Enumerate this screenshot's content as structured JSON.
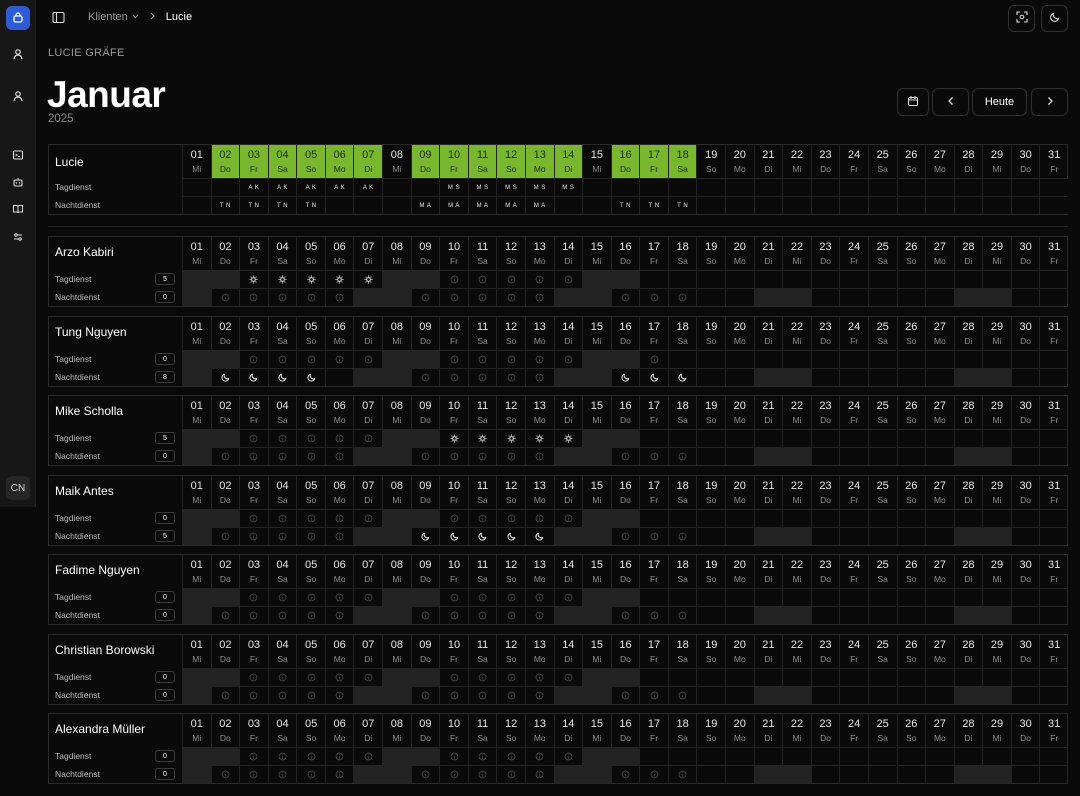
{
  "breadcrumb": {
    "parent": "Klienten",
    "current": "Lucie"
  },
  "client_name": "LUCIE GRÄFE",
  "month": "Januar",
  "year": "2025",
  "today_label": "Heute",
  "user_initials": "CN",
  "days": [
    {
      "d": "01",
      "w": "Mi"
    },
    {
      "d": "02",
      "w": "Do"
    },
    {
      "d": "03",
      "w": "Fr"
    },
    {
      "d": "04",
      "w": "Sa"
    },
    {
      "d": "05",
      "w": "So"
    },
    {
      "d": "06",
      "w": "Mo"
    },
    {
      "d": "07",
      "w": "Di"
    },
    {
      "d": "08",
      "w": "Mi"
    },
    {
      "d": "09",
      "w": "Do"
    },
    {
      "d": "10",
      "w": "Fr"
    },
    {
      "d": "11",
      "w": "Sa"
    },
    {
      "d": "12",
      "w": "So"
    },
    {
      "d": "13",
      "w": "Mo"
    },
    {
      "d": "14",
      "w": "Di"
    },
    {
      "d": "15",
      "w": "Mi"
    },
    {
      "d": "16",
      "w": "Do"
    },
    {
      "d": "17",
      "w": "Fr"
    },
    {
      "d": "18",
      "w": "Sa"
    },
    {
      "d": "19",
      "w": "So"
    },
    {
      "d": "20",
      "w": "Mo"
    },
    {
      "d": "21",
      "w": "Di"
    },
    {
      "d": "22",
      "w": "Mi"
    },
    {
      "d": "23",
      "w": "Do"
    },
    {
      "d": "24",
      "w": "Fr"
    },
    {
      "d": "25",
      "w": "Sa"
    },
    {
      "d": "26",
      "w": "So"
    },
    {
      "d": "27",
      "w": "Mo"
    },
    {
      "d": "28",
      "w": "Di"
    },
    {
      "d": "29",
      "w": "Mi"
    },
    {
      "d": "30",
      "w": "Do"
    },
    {
      "d": "31",
      "w": "Fr"
    }
  ],
  "labels": {
    "day": "Tagdienst",
    "night": "Nachtdienst"
  },
  "client_row": {
    "name": "Lucie",
    "covered_days": [
      2,
      3,
      4,
      5,
      6,
      7,
      9,
      10,
      11,
      12,
      13,
      14,
      16,
      17,
      18
    ],
    "tag_codes": {
      "3": "AK",
      "4": "AK",
      "5": "AK",
      "6": "AK",
      "7": "AK",
      "10": "MS",
      "11": "MS",
      "12": "MS",
      "13": "MS",
      "14": "MS"
    },
    "nacht_codes": {
      "2": "TN",
      "3": "TN",
      "4": "TN",
      "5": "TN",
      "9": "MA",
      "10": "MA",
      "11": "MA",
      "12": "MA",
      "13": "MA",
      "16": "TN",
      "17": "TN",
      "18": "TN"
    }
  },
  "colors": {
    "covered": "#79b72f",
    "accent": "#2d5bd6"
  },
  "employees": [
    {
      "name": "Arzo Kabiri",
      "tag_count": "5",
      "nacht_count": "0",
      "tag": {
        "3": "sun",
        "4": "sun",
        "5": "sun",
        "6": "sun",
        "7": "sun",
        "10": "info",
        "11": "info",
        "12": "info",
        "13": "info",
        "14": "info"
      },
      "nacht": {
        "2": "info",
        "3": "info",
        "4": "info",
        "5": "info",
        "6": "info",
        "9": "info",
        "10": "info",
        "11": "info",
        "12": "info",
        "13": "info",
        "16": "info",
        "17": "info",
        "18": "info"
      },
      "off_tag": [
        1,
        2,
        8,
        9,
        15,
        16
      ],
      "off_nacht": [
        1,
        7,
        8,
        14,
        15,
        21,
        22,
        28,
        29
      ]
    },
    {
      "name": "Tung Nguyen",
      "tag_count": "0",
      "nacht_count": "8",
      "tag": {
        "3": "info",
        "4": "info",
        "5": "info",
        "6": "info",
        "7": "info",
        "10": "info",
        "11": "info",
        "12": "info",
        "13": "info",
        "14": "info",
        "17": "info"
      },
      "nacht": {
        "2": "moon",
        "3": "moon",
        "4": "moon",
        "5": "moon",
        "9": "info",
        "10": "info",
        "11": "info",
        "12": "info",
        "13": "info",
        "16": "moon",
        "17": "moon",
        "18": "moon"
      },
      "off_tag": [
        1,
        2,
        8,
        9,
        15,
        16
      ],
      "off_nacht": [
        1,
        7,
        8,
        14,
        15,
        21,
        22,
        28,
        29
      ]
    },
    {
      "name": "Mike Scholla",
      "tag_count": "5",
      "nacht_count": "0",
      "tag": {
        "3": "info",
        "4": "info",
        "5": "info",
        "6": "info",
        "7": "info",
        "10": "sun",
        "11": "sun",
        "12": "sun",
        "13": "sun",
        "14": "sun"
      },
      "nacht": {
        "2": "info",
        "3": "info",
        "4": "info",
        "5": "info",
        "6": "info",
        "9": "info",
        "10": "info",
        "11": "info",
        "12": "info",
        "13": "info",
        "16": "info",
        "17": "info",
        "18": "info"
      },
      "off_tag": [
        1,
        2,
        8,
        9,
        15,
        16
      ],
      "off_nacht": [
        1,
        7,
        8,
        14,
        15,
        21,
        22,
        28,
        29
      ]
    },
    {
      "name": "Maik Antes",
      "tag_count": "0",
      "nacht_count": "5",
      "tag": {
        "3": "info",
        "4": "info",
        "5": "info",
        "6": "info",
        "7": "info",
        "10": "info",
        "11": "info",
        "12": "info",
        "13": "info",
        "14": "info"
      },
      "nacht": {
        "2": "info",
        "3": "info",
        "4": "info",
        "5": "info",
        "6": "info",
        "9": "moon",
        "10": "moon",
        "11": "moon",
        "12": "moon",
        "13": "moon",
        "16": "info",
        "17": "info",
        "18": "info"
      },
      "off_tag": [
        1,
        2,
        8,
        9,
        15,
        16
      ],
      "off_nacht": [
        1,
        7,
        8,
        14,
        15,
        21,
        22,
        28,
        29
      ]
    },
    {
      "name": "Fadime Nguyen",
      "tag_count": "0",
      "nacht_count": "0",
      "tag": {
        "3": "info",
        "4": "info",
        "5": "info",
        "6": "info",
        "7": "info",
        "10": "info",
        "11": "info",
        "12": "info",
        "13": "info",
        "14": "info"
      },
      "nacht": {
        "2": "info",
        "3": "info",
        "4": "info",
        "5": "info",
        "6": "info",
        "9": "info",
        "10": "info",
        "11": "info",
        "12": "info",
        "13": "info",
        "16": "info",
        "17": "info",
        "18": "info"
      },
      "off_tag": [
        1,
        2,
        8,
        9,
        15,
        16
      ],
      "off_nacht": [
        1,
        7,
        8,
        14,
        15,
        21,
        22,
        28,
        29
      ]
    },
    {
      "name": "Christian Borowski",
      "tag_count": "0",
      "nacht_count": "0",
      "tag": {
        "3": "info",
        "4": "info",
        "5": "info",
        "6": "info",
        "7": "info",
        "10": "info",
        "11": "info",
        "12": "info",
        "13": "info",
        "14": "info"
      },
      "nacht": {
        "2": "info",
        "3": "info",
        "4": "info",
        "5": "info",
        "6": "info",
        "9": "info",
        "10": "info",
        "11": "info",
        "12": "info",
        "13": "info",
        "16": "info",
        "17": "info",
        "18": "info"
      },
      "off_tag": [
        1,
        2,
        8,
        9,
        15,
        16
      ],
      "off_nacht": [
        1,
        7,
        8,
        14,
        15,
        21,
        22,
        28,
        29
      ]
    },
    {
      "name": "Alexandra Müller",
      "tag_count": "0",
      "nacht_count": "0",
      "tag": {
        "3": "info",
        "4": "info",
        "5": "info",
        "6": "info",
        "7": "info",
        "10": "info",
        "11": "info",
        "12": "info",
        "13": "info",
        "14": "info"
      },
      "nacht": {
        "2": "info",
        "3": "info",
        "4": "info",
        "5": "info",
        "6": "info",
        "9": "info",
        "10": "info",
        "11": "info",
        "12": "info",
        "13": "info",
        "16": "info",
        "17": "info",
        "18": "info"
      },
      "off_tag": [
        1,
        2,
        8,
        9,
        15,
        16
      ],
      "off_nacht": [
        1,
        7,
        8,
        14,
        15,
        21,
        22,
        28,
        29
      ]
    }
  ]
}
